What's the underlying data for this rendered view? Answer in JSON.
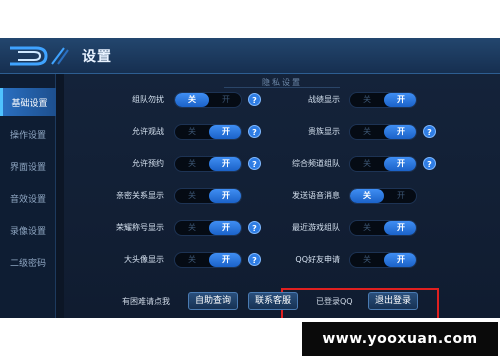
{
  "header": {
    "title": "设置"
  },
  "sidebar": {
    "items": [
      {
        "label": "基础设置",
        "active": true
      },
      {
        "label": "操作设置",
        "active": false
      },
      {
        "label": "界面设置",
        "active": false
      },
      {
        "label": "音效设置",
        "active": false
      },
      {
        "label": "录像设置",
        "active": false
      },
      {
        "label": "二级密码",
        "active": false
      }
    ]
  },
  "panel": {
    "title": "隐私设置",
    "toggle_labels": {
      "off": "关",
      "on": "开"
    },
    "help_glyph": "?",
    "left_settings": [
      {
        "label": "组队勿扰",
        "state": "off",
        "help": true
      },
      {
        "label": "允许观战",
        "state": "on",
        "help": true
      },
      {
        "label": "允许预约",
        "state": "on",
        "help": true
      },
      {
        "label": "亲密关系显示",
        "state": "on",
        "help": false
      },
      {
        "label": "荣耀称号显示",
        "state": "on",
        "help": true
      },
      {
        "label": "大头像显示",
        "state": "on",
        "help": true
      }
    ],
    "right_settings": [
      {
        "label": "战绩显示",
        "state": "on",
        "help": false
      },
      {
        "label": "贵族显示",
        "state": "on",
        "help": true
      },
      {
        "label": "综合频道组队",
        "state": "on",
        "help": true
      },
      {
        "label": "发送语音消息",
        "state": "off",
        "help": false
      },
      {
        "label": "最近游戏组队",
        "state": "on",
        "help": false
      },
      {
        "label": "QQ好友申请",
        "state": "on",
        "help": false,
        "highlighted": true
      }
    ]
  },
  "footer": {
    "problem_text": "有困难请点我",
    "self_query_label": "自助查询",
    "contact_label": "联系客服",
    "logged_in_text": "已登录QQ",
    "logout_label": "退出登录"
  },
  "watermark": {
    "text": "www.yooxuan.com"
  },
  "colors": {
    "accent_blue": "#2f7de4",
    "highlight_red": "#e02020",
    "background": "#0c1626"
  }
}
